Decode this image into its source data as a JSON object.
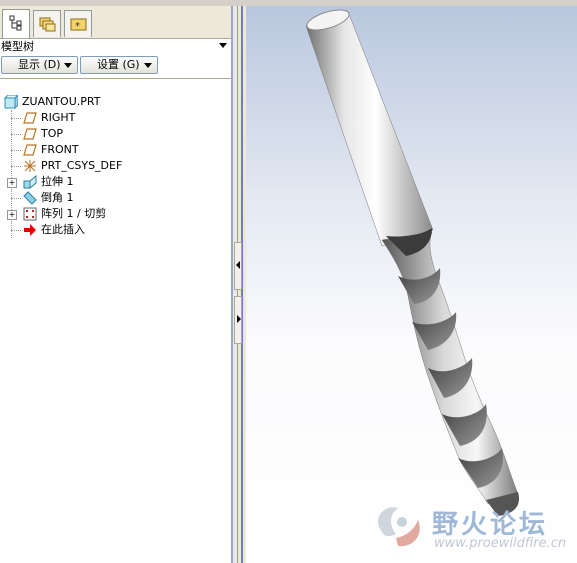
{
  "panel": {
    "title": "模型树",
    "buttons": [
      {
        "label": "显示 (D)"
      },
      {
        "label": "设置 (G)"
      }
    ]
  },
  "tree": {
    "root": "ZUANTOU.PRT",
    "items": [
      {
        "label": "RIGHT",
        "icon": "datum-plane-icon"
      },
      {
        "label": "TOP",
        "icon": "datum-plane-icon"
      },
      {
        "label": "FRONT",
        "icon": "datum-plane-icon"
      },
      {
        "label": "PRT_CSYS_DEF",
        "icon": "coordinate-system-icon"
      },
      {
        "label": "拉伸 1",
        "icon": "extrude-icon",
        "expandable": true
      },
      {
        "label": "倒角 1",
        "icon": "chamfer-icon"
      },
      {
        "label": "阵列 1 / 切剪",
        "icon": "pattern-icon",
        "expandable": true
      },
      {
        "label": "在此插入",
        "icon": "insert-here-arrow-icon"
      }
    ]
  },
  "watermark": {
    "title": "野火论坛",
    "url": "www.proewildfire.cn"
  },
  "colors": {
    "viewport_top": "#b9c7de",
    "viewport_bottom": "#ffffff",
    "panel_bg": "#ece9d8",
    "insert_arrow": "#e00000"
  }
}
